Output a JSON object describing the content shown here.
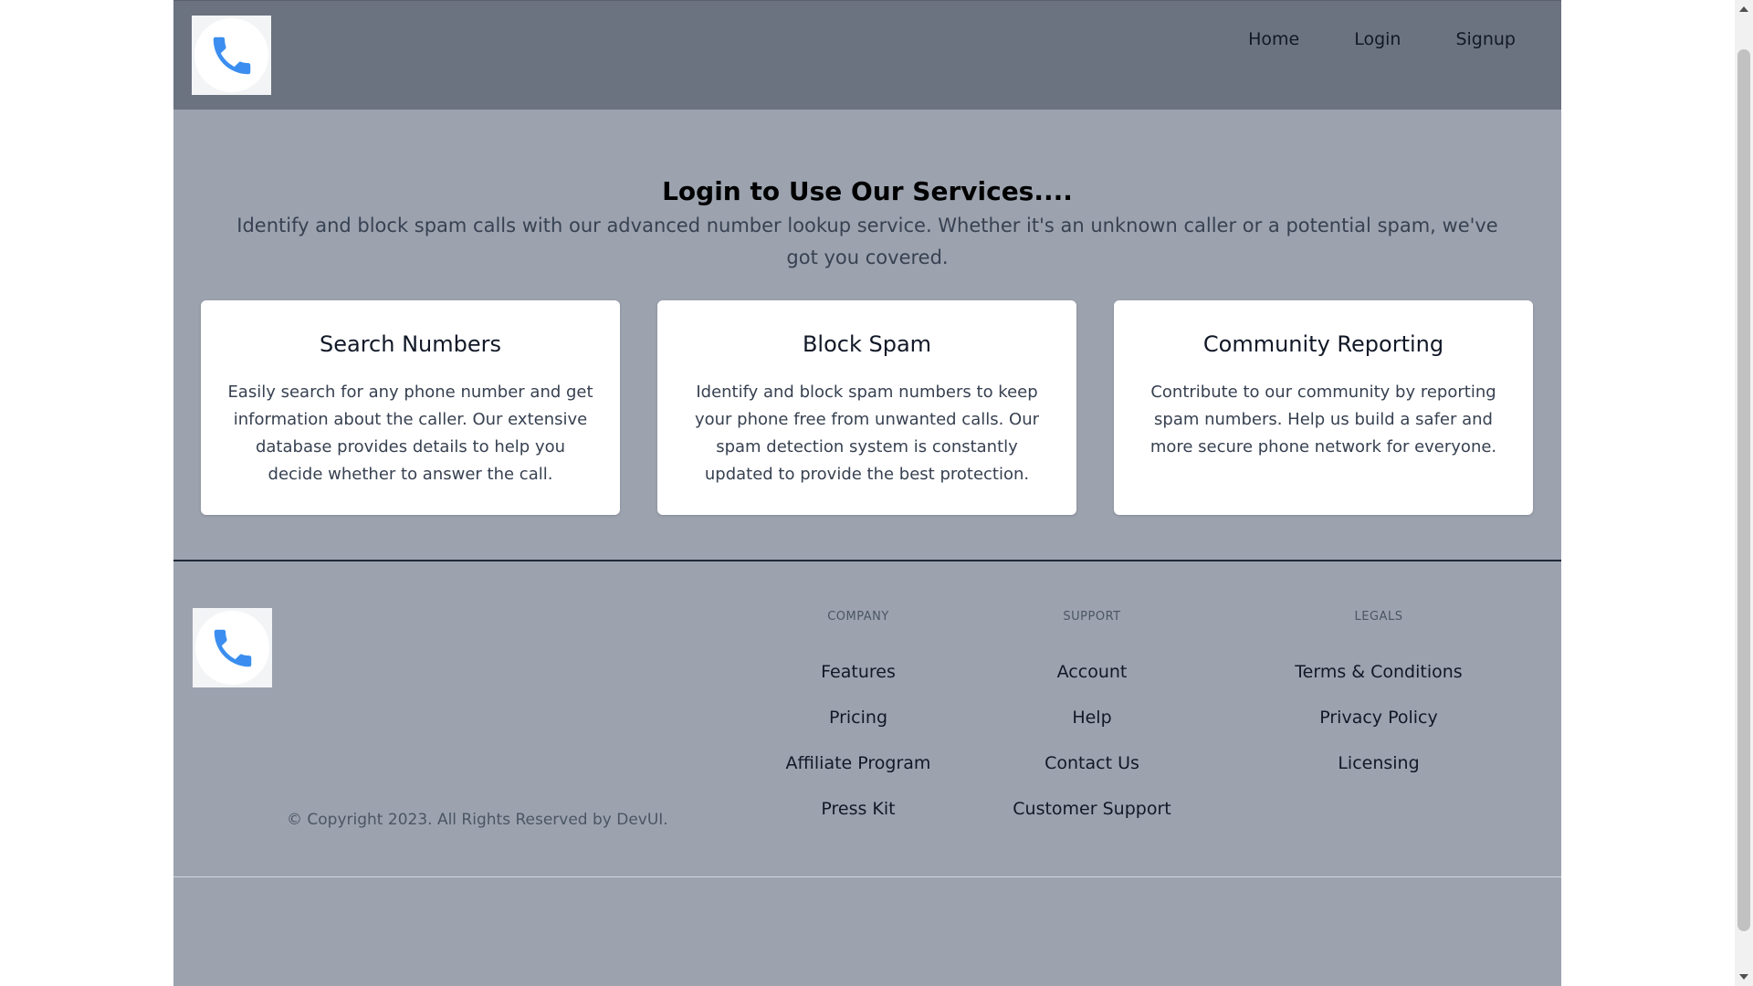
{
  "header": {
    "logo_icon": "phone-icon",
    "nav": [
      {
        "label": "Home"
      },
      {
        "label": "Login"
      },
      {
        "label": "Signup"
      }
    ]
  },
  "hero": {
    "title": "Login to Use Our Services....",
    "text": "Identify and block spam calls with our advanced number lookup service. Whether it's an unknown caller or a potential spam, we've got you covered."
  },
  "cards": [
    {
      "title": "Search Numbers",
      "text": "Easily search for any phone number and get information about the caller. Our extensive database provides details to help you decide whether to answer the call."
    },
    {
      "title": "Block Spam",
      "text": "Identify and block spam numbers to keep your phone free from unwanted calls. Our spam detection system is constantly updated to provide the best protection."
    },
    {
      "title": "Community Reporting",
      "text": "Contribute to our community by reporting spam numbers. Help us build a safer and more secure phone network for everyone."
    }
  ],
  "footer": {
    "logo_icon": "phone-icon",
    "columns": [
      {
        "title": "COMPANY",
        "links": [
          "Features",
          "Pricing",
          "Affiliate Program",
          "Press Kit"
        ]
      },
      {
        "title": "SUPPORT",
        "links": [
          "Account",
          "Help",
          "Contact Us",
          "Customer Support"
        ]
      },
      {
        "title": "LEGALS",
        "links": [
          "Terms & Conditions",
          "Privacy Policy",
          "Licensing"
        ]
      }
    ],
    "copyright": "© Copyright 2023. All Rights Reserved by DevUI."
  },
  "colors": {
    "header_bg": "#6b7280",
    "page_bg": "#9ca3af",
    "card_bg": "#ffffff",
    "phone_icon": "#3b8ef0"
  }
}
